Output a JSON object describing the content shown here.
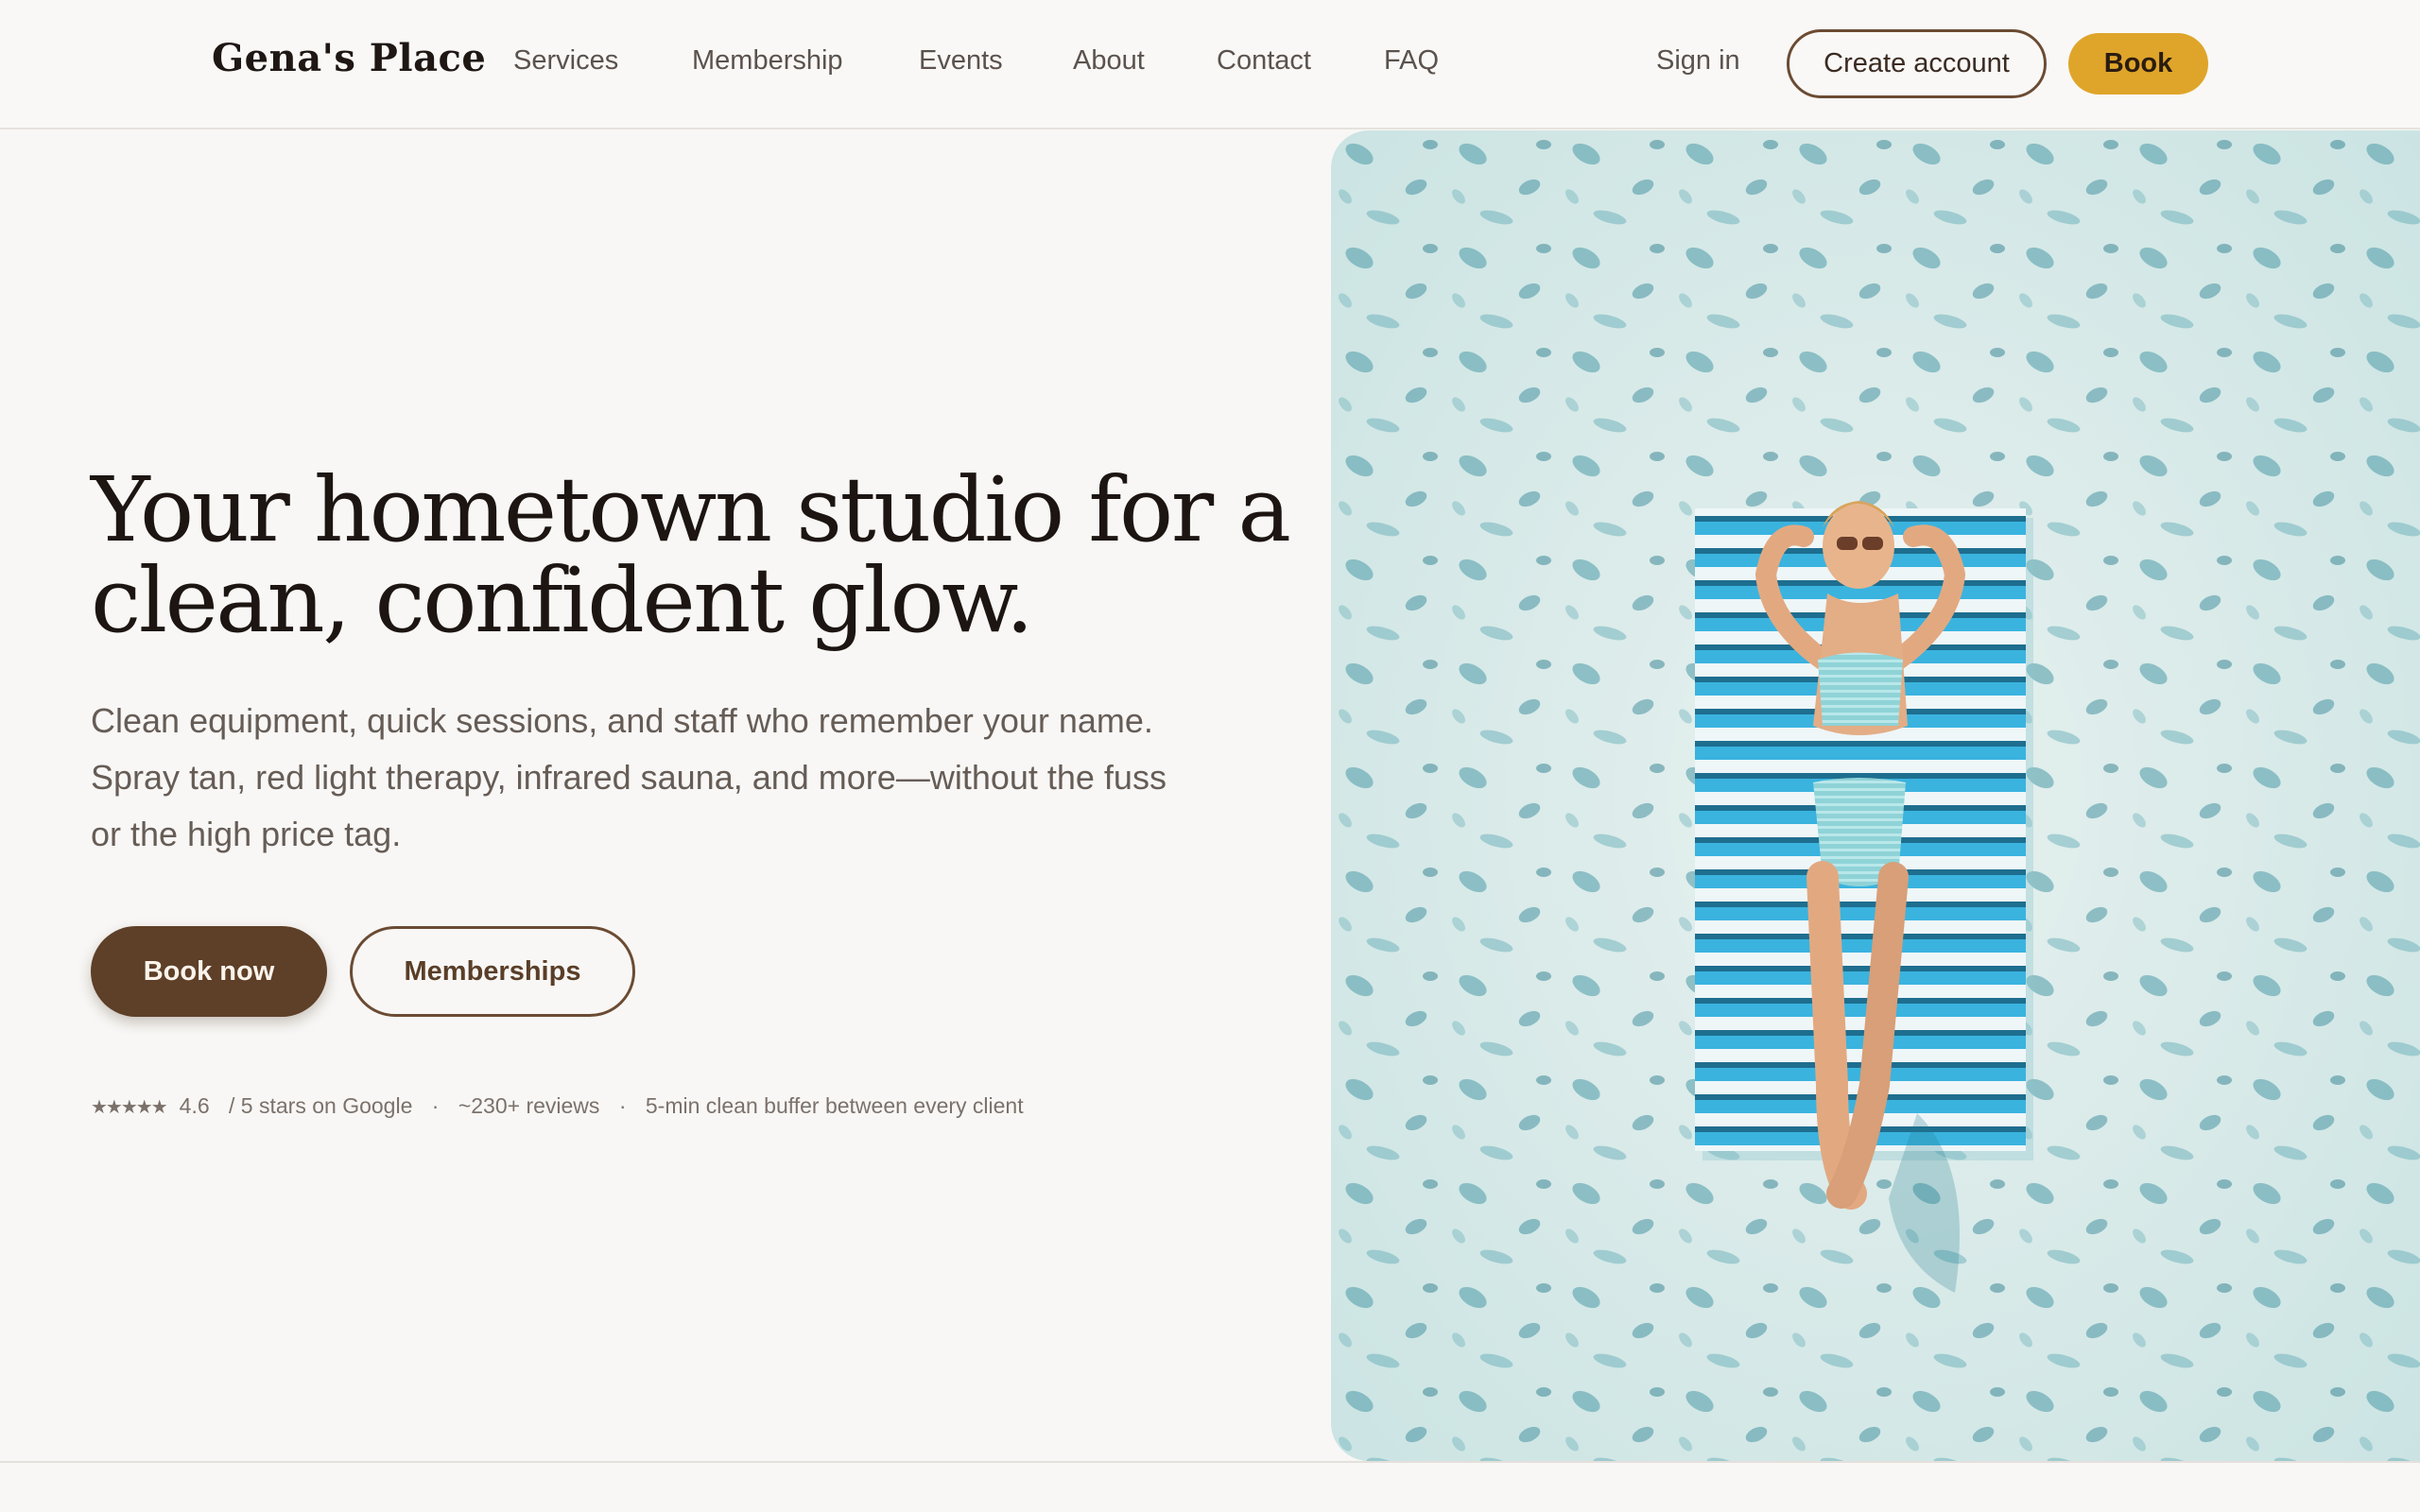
{
  "brand": {
    "name": "Gena's Place"
  },
  "nav": {
    "items": [
      "Services",
      "Membership",
      "Events",
      "About",
      "Contact",
      "FAQ"
    ],
    "sign_in": "Sign in",
    "create_account": "Create account",
    "book": "Book"
  },
  "hero": {
    "title_line1": "Your hometown studio for a",
    "title_line2": "clean, confident glow.",
    "subtitle_line1": "Clean equipment, quick sessions, and staff who remember your name.",
    "subtitle_line2": "Spray tan, red light therapy, infrared sauna, and more—without the fuss",
    "subtitle_line3": "or the high price tag.",
    "primary_cta": "Book now",
    "secondary_cta": "Memberships"
  },
  "proof": {
    "stars": "★★★★★",
    "rating": "4.6",
    "rating_suffix": "/ 5 stars on Google",
    "separator": "·",
    "reviews": "~230+ reviews",
    "buffer": "5-min clean buffer between every client"
  },
  "colors": {
    "accent_gold": "#dfa52a",
    "brand_brown": "#5e3f27",
    "background": "#f8f7f5"
  }
}
